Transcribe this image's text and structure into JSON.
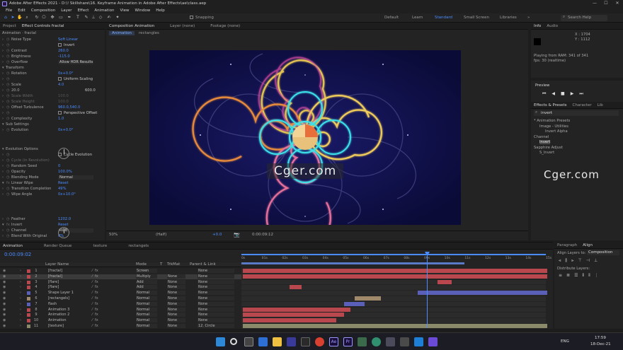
{
  "window": {
    "title": "Adobe After Effects 2021 - D:\\! Skillshare\\16. Keyframe Animation in Adobe After Effects\\ae\\class.aep",
    "controls": [
      "—",
      "☐",
      "✕"
    ]
  },
  "menu": [
    "File",
    "Edit",
    "Composition",
    "Layer",
    "Effect",
    "Animation",
    "View",
    "Window",
    "Help"
  ],
  "toolbar": {
    "snapping": "Snapping",
    "workspaces": [
      "Default",
      "Learn",
      "Standard",
      "Small Screen",
      "Libraries"
    ],
    "active_workspace": "Standard",
    "search_placeholder": "Search Help"
  },
  "project_panel": {
    "tabs": [
      "Project",
      "Effect Controls fractal"
    ],
    "title": "Animation · fractal",
    "effect_rows": [
      {
        "label": "Noise Type",
        "value": "Soft Linear",
        "kind": "text"
      },
      {
        "label": "",
        "value": "Invert",
        "kind": "check"
      },
      {
        "label": "Contrast",
        "value": "260.0",
        "kind": "num"
      },
      {
        "label": "Brightness",
        "value": "-115.0",
        "kind": "num"
      },
      {
        "label": "Overflow",
        "value": "Allow HDR Results",
        "kind": "dd"
      },
      {
        "label": "Transform",
        "value": "",
        "kind": "group"
      },
      {
        "label": "Rotation",
        "value": "0x+0.0°",
        "kind": "num"
      },
      {
        "label": "",
        "value": "Uniform Scaling",
        "kind": "check"
      },
      {
        "label": "Scale",
        "value": "4.0",
        "kind": "num"
      },
      {
        "label": "20.0",
        "value": "600.0",
        "kind": "range"
      },
      {
        "label": "Scale Width",
        "value": "100.0",
        "kind": "dim"
      },
      {
        "label": "Scale Height",
        "value": "100.0",
        "kind": "dim"
      },
      {
        "label": "Offset Turbulence",
        "value": "960.0,540.0",
        "kind": "num"
      },
      {
        "label": "",
        "value": "Perspective Offset",
        "kind": "check"
      },
      {
        "label": "Complexity",
        "value": "1.0",
        "kind": "num"
      },
      {
        "label": "Sub Settings",
        "value": "",
        "kind": "group"
      },
      {
        "label": "Evolution",
        "value": "0x+0.0°",
        "kind": "num"
      }
    ],
    "effect_rows_2": [
      {
        "label": "Evolution Options",
        "value": "",
        "kind": "group"
      },
      {
        "label": "",
        "value": "Cycle Evolution",
        "kind": "check"
      },
      {
        "label": "Cycle (in Revolution)",
        "value": "",
        "kind": "dim"
      },
      {
        "label": "Random Seed",
        "value": "0",
        "kind": "num"
      },
      {
        "label": "Opacity",
        "value": "100.0%",
        "kind": "num"
      },
      {
        "label": "Blending Mode",
        "value": "Normal",
        "kind": "dd"
      },
      {
        "label": "Linear Wipe",
        "value": "Reset",
        "kind": "fx"
      },
      {
        "label": "Transition Completion",
        "value": "49%",
        "kind": "num"
      },
      {
        "label": "Wipe Angle",
        "value": "0x+10.0°",
        "kind": "num"
      }
    ],
    "effect_rows_3": [
      {
        "label": "Feather",
        "value": "1202.0",
        "kind": "num"
      },
      {
        "label": "Invert",
        "value": "Reset",
        "kind": "fx"
      },
      {
        "label": "Channel",
        "value": "RGB",
        "kind": "dd"
      },
      {
        "label": "Blend With Original",
        "value": "0%",
        "kind": "num"
      }
    ]
  },
  "viewer": {
    "tabs": [
      "Composition Animation",
      "Layer (none)",
      "Footage (none)"
    ],
    "breadcrumbs": [
      "Animation",
      "rectangles"
    ],
    "zoom": "50%",
    "quality": "(Half)",
    "exposure": "+0.0",
    "timecode": "0:00:09:12",
    "watermark": "Cger.com"
  },
  "info_panel": {
    "tabs": [
      "Info",
      "Audio"
    ],
    "x": "X : 1704",
    "y": "Y : 1112",
    "status": "Playing from RAM: 341 of 341",
    "fps": "fps: 30 (realtime)"
  },
  "preview_panel": {
    "title": "Preview"
  },
  "effects_panel": {
    "tabs": [
      "Effects & Presets",
      "Character",
      "Lib"
    ],
    "search": "invert",
    "tree": [
      {
        "label": "* Animation Presets",
        "level": 0
      },
      {
        "label": "Image - Utilities",
        "level": 1
      },
      {
        "label": "Invert Alpha",
        "level": 2
      },
      {
        "label": "Channel",
        "level": 0
      },
      {
        "label": "Invert",
        "level": 1
      },
      {
        "label": "Sapphire Adjust",
        "level": 0
      },
      {
        "label": "S_Invert",
        "level": 1
      }
    ],
    "watermark": "Cger.com"
  },
  "timeline": {
    "tabs": [
      "Animation",
      "Render Queue",
      "texture",
      "rectangels"
    ],
    "timecode": "0:00:09:02",
    "columns": [
      "Layer Name",
      "Mode",
      "T",
      "TrkMat",
      "Parent & Link"
    ],
    "ruler": [
      "0s",
      "01s",
      "02s",
      "03s",
      "04s",
      "05s",
      "06s",
      "07s",
      "08s",
      "09s",
      "10s",
      "11s",
      "12s",
      "13s",
      "14s",
      "15s"
    ],
    "playhead_seconds": 9.07,
    "duration_seconds": 15,
    "layers": [
      {
        "num": "1",
        "name": "[fractal]",
        "mode": "Screen",
        "trk": "",
        "parent": "None",
        "color": "#b8484e",
        "start": 0,
        "end": 15
      },
      {
        "num": "2",
        "name": "[fractal]",
        "mode": "Multiply",
        "trk": "None",
        "parent": "None",
        "color": "#b8484e",
        "start": 0,
        "end": 15
      },
      {
        "num": "3",
        "name": "[flare]",
        "mode": "Add",
        "trk": "None",
        "parent": "None",
        "color": "#b8484e",
        "start": 9.6,
        "end": 10.3
      },
      {
        "num": "4",
        "name": "[flare]",
        "mode": "Add",
        "trk": "None",
        "parent": "None",
        "color": "#b8484e",
        "start": 2.3,
        "end": 2.9
      },
      {
        "num": "5",
        "name": "Shape Layer 1",
        "mode": "Normal",
        "trk": "None",
        "parent": "None",
        "color": "#5a5fb8",
        "start": 8.6,
        "end": 15
      },
      {
        "num": "6",
        "name": "[rectangels]",
        "mode": "Normal",
        "trk": "None",
        "parent": "None",
        "color": "#a0886a",
        "start": 5.5,
        "end": 6.8
      },
      {
        "num": "7",
        "name": "flash",
        "mode": "Normal",
        "trk": "None",
        "parent": "None",
        "color": "#5a5fb8",
        "start": 5.0,
        "end": 6.0
      },
      {
        "num": "8",
        "name": "Animation 3",
        "mode": "Normal",
        "trk": "None",
        "parent": "None",
        "color": "#b8484e",
        "start": 0,
        "end": 5.3
      },
      {
        "num": "9",
        "name": "Animation 2",
        "mode": "Normal",
        "trk": "None",
        "parent": "None",
        "color": "#b8484e",
        "start": 0,
        "end": 5.0
      },
      {
        "num": "10",
        "name": "Animation",
        "mode": "Normal",
        "trk": "None",
        "parent": "None",
        "color": "#b8484e",
        "start": 0,
        "end": 4.6
      },
      {
        "num": "11",
        "name": "[texture]",
        "mode": "Normal",
        "trk": "None",
        "parent": "12. Circle",
        "color": "#8a8a6a",
        "start": 0,
        "end": 15
      }
    ]
  },
  "right_bottom": {
    "tabs": [
      "Paragraph",
      "Align"
    ],
    "align_to_label": "Align Layers to:",
    "align_to_value": "Composition",
    "distribute": "Distribute Layers:"
  },
  "taskbar": {
    "lang": "ENG",
    "time": "17:59",
    "date": "18-Dec-21"
  }
}
